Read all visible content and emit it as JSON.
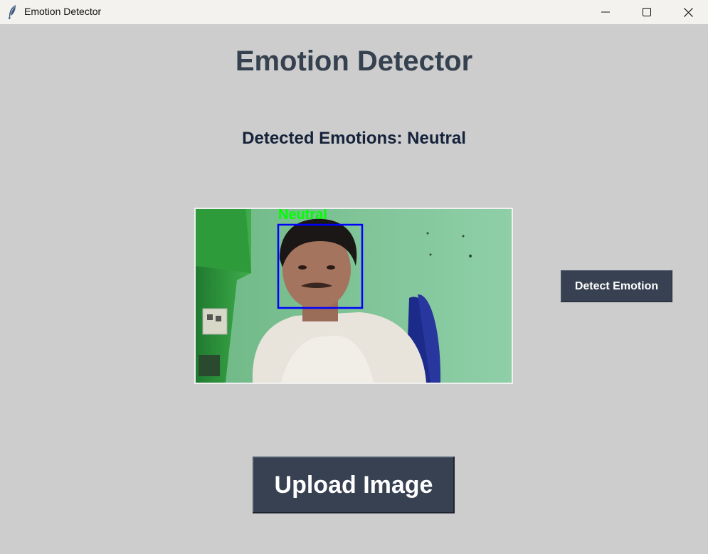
{
  "window": {
    "title": "Emotion Detector",
    "icon": "feather-icon",
    "controls": {
      "minimize": "minimize-icon",
      "maximize": "maximize-icon",
      "close": "close-icon"
    }
  },
  "main": {
    "heading": "Emotion Detector",
    "detected_text": "Detected Emotions: Neutral",
    "image": {
      "overlay_label": "Neutral",
      "overlay_label_color": "#00ff00",
      "box_color": "#0000ff"
    },
    "detect_button_label": "Detect Emotion",
    "upload_button_label": "Upload Image"
  },
  "colors": {
    "background": "#cdcdcd",
    "button_bg": "#374152",
    "heading": "#364150"
  }
}
